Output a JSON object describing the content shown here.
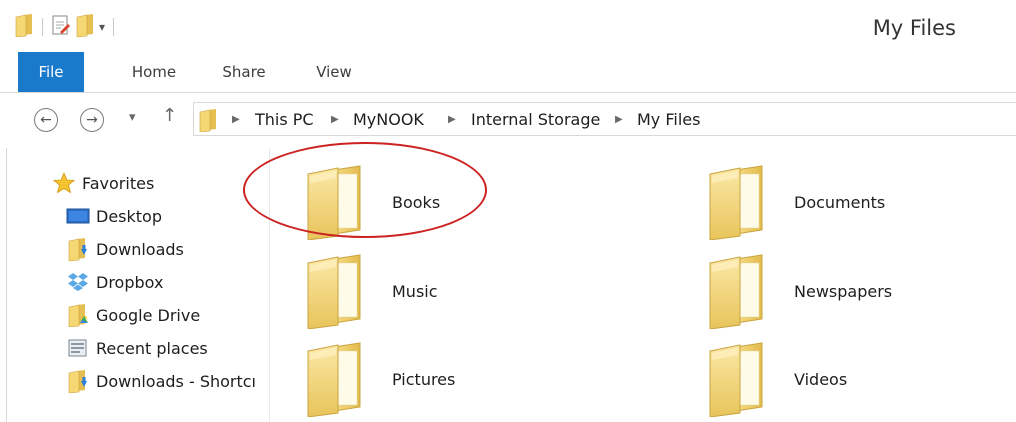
{
  "window": {
    "title": "My Files"
  },
  "ribbon": {
    "tabs": [
      "File",
      "Home",
      "Share",
      "View"
    ]
  },
  "address": {
    "crumbs": [
      "This PC",
      "MyNOOK",
      "Internal Storage",
      "My Files"
    ]
  },
  "navigation": {
    "items": [
      {
        "label": "Favorites",
        "icon": "star-icon"
      },
      {
        "label": "Desktop",
        "icon": "desktop-icon"
      },
      {
        "label": "Downloads",
        "icon": "downloads-folder-icon"
      },
      {
        "label": "Dropbox",
        "icon": "dropbox-icon"
      },
      {
        "label": "Google Drive",
        "icon": "google-drive-icon"
      },
      {
        "label": "Recent places",
        "icon": "recent-places-icon"
      },
      {
        "label": "Downloads - Shortcı",
        "icon": "downloads-shortcut-icon"
      }
    ]
  },
  "content": {
    "folders": [
      "Books",
      "Documents",
      "Music",
      "Newspapers",
      "Pictures",
      "Videos"
    ]
  },
  "colors": {
    "file_tab": "#1979ca",
    "highlight_oval": "#cc2222",
    "folder": "#f3d774"
  }
}
